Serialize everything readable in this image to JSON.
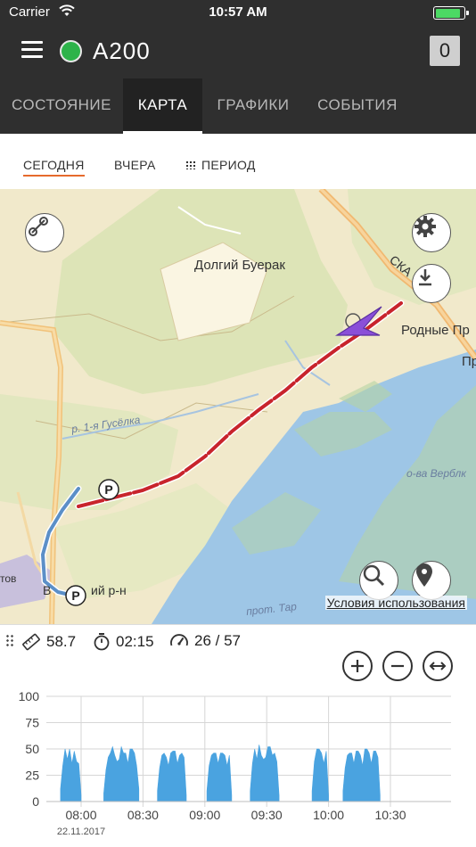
{
  "status_bar": {
    "carrier": "Carrier",
    "time": "10:57 AM",
    "battery_level": 0.9
  },
  "app_bar": {
    "unit_name": "A200",
    "counter": "0",
    "status_color": "#2db34a"
  },
  "tabs": [
    {
      "label": "СОСТОЯНИЕ"
    },
    {
      "label": "КАРТА"
    },
    {
      "label": "ГРАФИКИ"
    },
    {
      "label": "СОБЫТИЯ"
    }
  ],
  "subtabs": {
    "today": "СЕГОДНЯ",
    "yesterday": "ВЧЕРА",
    "period": "ПЕРИОД"
  },
  "map": {
    "labels": {
      "village_1": "Долгий Буерак",
      "village_2": "Родные Пр",
      "village_3": "Пр",
      "river_1": "р. 1-я Гусёлка",
      "island": "о-ва Верблк",
      "channel": "прот. Тар",
      "district": "ий р-н",
      "district_prefix": "В",
      "road": "СКА",
      "left_edge": "тов"
    },
    "terms_link": "Условия использования",
    "track_color": "#c8242c",
    "water_color": "#9ec6e6"
  },
  "stats": {
    "distance": "58.7",
    "duration": "02:15",
    "speed": "26 / 57"
  },
  "chart_data": {
    "type": "area",
    "ylim": [
      0,
      100
    ],
    "yticks": [
      0,
      25,
      50,
      75,
      100
    ],
    "xticks": [
      "08:00",
      "08:30",
      "09:00",
      "09:30",
      "10:00",
      "10:30"
    ],
    "date_label": "22.11.2017",
    "color": "#4aa3e0",
    "segments": [
      {
        "start": "07:50",
        "end": "08:00",
        "values": [
          12,
          38,
          50,
          44,
          50,
          40,
          48,
          42,
          36,
          10
        ]
      },
      {
        "start": "08:11",
        "end": "08:28",
        "values": [
          8,
          34,
          42,
          50,
          52,
          48,
          38,
          44,
          52,
          50,
          46,
          40,
          50,
          54,
          46,
          38,
          12
        ]
      },
      {
        "start": "08:37",
        "end": "08:51",
        "values": [
          10,
          36,
          44,
          50,
          42,
          38,
          46,
          52,
          48,
          40,
          44,
          50,
          42,
          10
        ]
      },
      {
        "start": "09:01",
        "end": "09:13",
        "values": [
          10,
          38,
          44,
          50,
          46,
          40,
          46,
          50,
          44,
          38,
          44,
          10
        ]
      },
      {
        "start": "09:22",
        "end": "09:36",
        "values": [
          10,
          40,
          50,
          44,
          54,
          48,
          40,
          46,
          52,
          56,
          44,
          50,
          38,
          10
        ]
      },
      {
        "start": "09:52",
        "end": "10:00",
        "values": [
          10,
          42,
          50,
          54,
          46,
          40,
          48,
          10
        ]
      },
      {
        "start": "10:07",
        "end": "10:25",
        "values": [
          10,
          36,
          44,
          50,
          46,
          40,
          48,
          52,
          44,
          38,
          50,
          54,
          46,
          40,
          48,
          52,
          42,
          10
        ]
      }
    ]
  }
}
